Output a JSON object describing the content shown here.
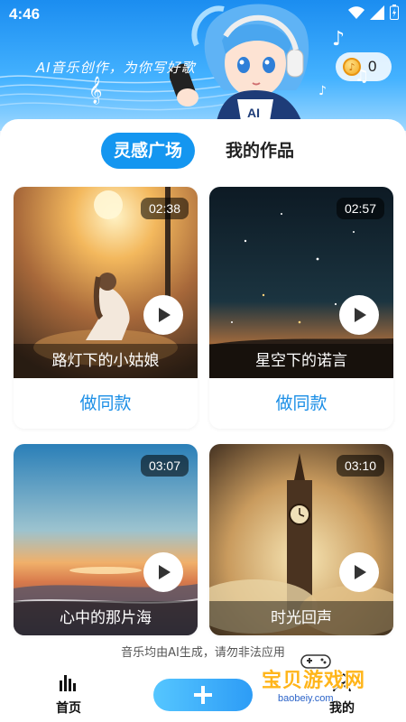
{
  "status": {
    "time": "4:46"
  },
  "banner": {
    "slogan": "AI音乐创作，为你写好歌",
    "coins": "0"
  },
  "tabs": [
    {
      "label": "灵感广场",
      "active": true
    },
    {
      "label": "我的作品",
      "active": false
    }
  ],
  "cards": [
    {
      "title": "路灯下的小姑娘",
      "duration": "02:38",
      "action": "做同款"
    },
    {
      "title": "星空下的诺言",
      "duration": "02:57",
      "action": "做同款"
    },
    {
      "title": "心中的那片海",
      "duration": "03:07",
      "action": ""
    },
    {
      "title": "时光回声",
      "duration": "03:10",
      "action": ""
    }
  ],
  "notice": "音乐均由AI生成，请勿非法应用",
  "bottom_nav": {
    "home_label": "首页",
    "mine_label": "我的"
  },
  "watermark": {
    "text": "宝贝游戏网",
    "url": "baobeiy.com"
  },
  "colors": {
    "accent": "#1496f0",
    "link": "#1a8ee6"
  }
}
